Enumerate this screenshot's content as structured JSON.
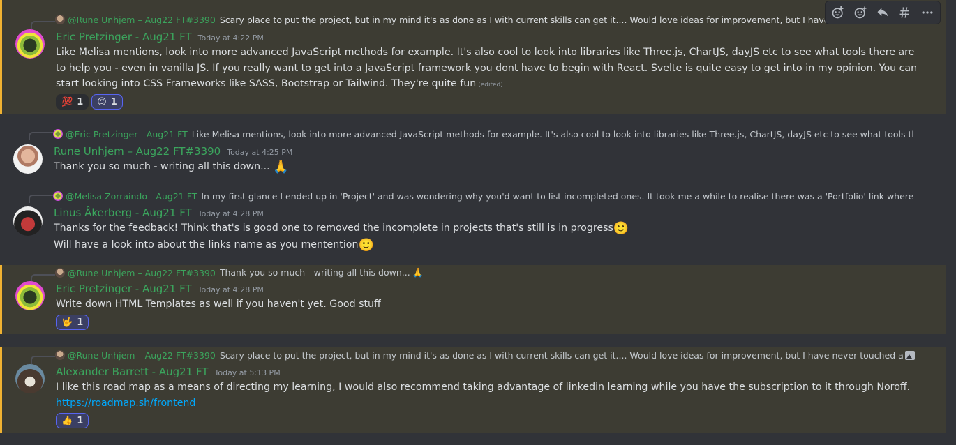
{
  "toolbar": {
    "add_reaction_icon": "emoji-add",
    "super_reaction_icon": "super-reaction",
    "reply_icon": "reply-arrow",
    "thread_icon": "thread-hash",
    "more_icon": "ellipsis"
  },
  "messages": [
    {
      "reply_author": "@Rune Unhjem – Aug22 FT#3390",
      "reply_text": "Scary place to put the project, but in my mind it's as done as I with current skills can get it.... Would love ideas for improvement, but I have never touched a library or",
      "username": "Eric Pretzinger - Aug21 FT",
      "timestamp": "Today at 4:22 PM",
      "text": "Like Melisa mentions, look into more advanced JavaScript methods for example. It's also cool to look into libraries like Three.js, ChartJS, dayJS etc to see what tools there are to help you - even in vanilla JS. If you really want to get into a JavaScript framework you dont have to begin with React. Svelte is quite easy to get into in my opinion. You can start looking into CSS Frameworks like SASS, Bootstrap or Tailwind. They're quite fun",
      "edited": "(edited)",
      "reactions": [
        {
          "emoji": "💯",
          "count": "1"
        },
        {
          "emoji": "😍",
          "count": "1"
        }
      ]
    },
    {
      "reply_author": "@Eric Pretzinger - Aug21 FT",
      "reply_text": "Like Melisa mentions, look into more advanced JavaScript methods for example. It's also cool to look into libraries like Three.js, ChartJS, dayJS etc to see what tools there are to",
      "username": "Rune Unhjem – Aug22 FT#3390",
      "timestamp": "Today at 4:25 PM",
      "text": "Thank you so much - writing all this down...",
      "emoji": "🙏"
    },
    {
      "reply_author": "@Melisa Zorraindo - Aug21 FT",
      "reply_text": "In my first glance I ended up in 'Project' and was wondering why you'd want to list incompleted ones. It took me a while to realise there was a 'Portfolio' link where you have all",
      "username": "Linus Åkerberg - Aug21 FT",
      "timestamp": "Today at 4:28 PM",
      "line1": "Thanks for the feedback! Think that's is good one to removed the incomplete in projects that's still is in progress",
      "line2": "Will have a look into about the links name as you mentention",
      "emoji": "🙂"
    },
    {
      "reply_author": "@Rune Unhjem – Aug22 FT#3390",
      "reply_text": "Thank you so much - writing all this down...",
      "reply_emoji": "🙏",
      "username": "Eric Pretzinger - Aug21 FT",
      "timestamp": "Today at 4:28 PM",
      "text": "Write down HTML Templates as well if you haven't yet. Good stuff",
      "reactions": [
        {
          "emoji": "🤟",
          "count": "1"
        }
      ]
    },
    {
      "reply_author": "@Rune Unhjem – Aug22 FT#3390",
      "reply_text": "Scary place to put the project, but in my mind it's as done as I with current skills can get it.... Would love ideas for improvement, but I have never touched a library or r",
      "username": "Alexander Barrett - Aug21 FT",
      "timestamp": "Today at 5:13 PM",
      "text": "I like this road map as a means of directing my learning, I would also recommend taking advantage of linkedin learning while you have the subscription to it through Noroff.",
      "link": "https://roadmap.sh/frontend",
      "reactions": [
        {
          "emoji": "👍",
          "count": "1"
        }
      ]
    }
  ]
}
